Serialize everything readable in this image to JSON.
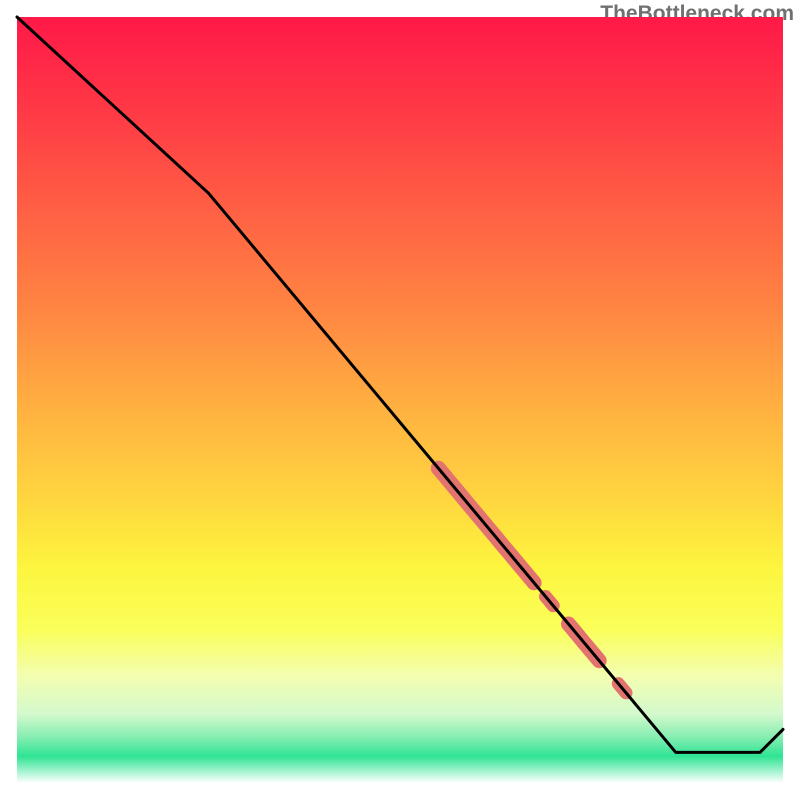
{
  "watermark": "TheBottleneck.com",
  "chart_data": {
    "type": "line",
    "title": "",
    "xlabel": "",
    "ylabel": "",
    "xlim": [
      0,
      100
    ],
    "ylim": [
      0,
      100
    ],
    "grid": false,
    "curve": {
      "description": "Bottleneck curve descending from top-left to a flat valley near bottom-right, then rising at far right edge",
      "points": [
        {
          "x": 0,
          "y": 100
        },
        {
          "x": 25,
          "y": 77
        },
        {
          "x": 86,
          "y": 4
        },
        {
          "x": 97,
          "y": 4
        },
        {
          "x": 100,
          "y": 7
        }
      ]
    },
    "highlight_segments": [
      {
        "x_start": 55,
        "x_end": 67.5,
        "thick": true
      },
      {
        "x_start": 69,
        "x_end": 70,
        "thick": false
      },
      {
        "x_start": 72,
        "x_end": 76,
        "thick": true
      },
      {
        "x_start": 78.5,
        "x_end": 79.5,
        "thick": false
      }
    ],
    "highlight_color": "#e2736e",
    "background_gradient": [
      {
        "stop": 0.0,
        "color": "#ff1948"
      },
      {
        "stop": 0.12,
        "color": "#ff3846"
      },
      {
        "stop": 0.25,
        "color": "#ff5f44"
      },
      {
        "stop": 0.38,
        "color": "#ff8542"
      },
      {
        "stop": 0.5,
        "color": "#ffad41"
      },
      {
        "stop": 0.62,
        "color": "#ffd33f"
      },
      {
        "stop": 0.72,
        "color": "#fdf53e"
      },
      {
        "stop": 0.8,
        "color": "#faff5a"
      },
      {
        "stop": 0.86,
        "color": "#f3feb0"
      },
      {
        "stop": 0.91,
        "color": "#d3f9cc"
      },
      {
        "stop": 0.94,
        "color": "#86eeb2"
      },
      {
        "stop": 0.965,
        "color": "#2fe494"
      },
      {
        "stop": 1.0,
        "color": "#ffffff"
      }
    ]
  }
}
